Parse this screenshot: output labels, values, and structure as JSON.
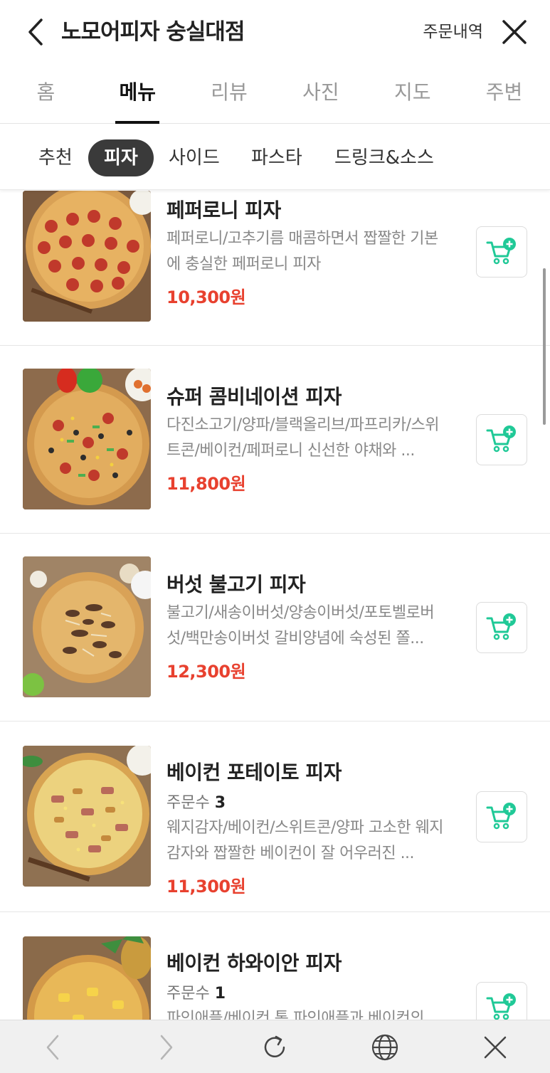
{
  "header": {
    "title": "노모어피자 숭실대점",
    "order_history": "주문내역"
  },
  "main_tabs": [
    "홈",
    "메뉴",
    "리뷰",
    "사진",
    "지도",
    "주변"
  ],
  "active_main_tab": "메뉴",
  "sub_tabs": [
    "추천",
    "피자",
    "사이드",
    "파스타",
    "드링크&소스"
  ],
  "active_sub_tab": "피자",
  "colors": {
    "price": "#e8412f",
    "cart_icon": "#20c997",
    "active_chip_bg": "#3a3a3a"
  },
  "menu_items": [
    {
      "name": "페퍼로니 피자",
      "description": "페퍼로니/고추기름 매콤하면서 짭짤한 기본에 충실한 페퍼로니 피자",
      "price": "10,300원"
    },
    {
      "name": "슈퍼 콤비네이션 피자",
      "description": "다진소고기/양파/블랙올리브/파프리카/스위트콘/베이컨/페퍼로니 신선한 야채와 ...",
      "price": "11,800원"
    },
    {
      "name": "버섯 불고기 피자",
      "description": "불고기/새송이버섯/양송이버섯/포토벨로버섯/백만송이버섯 갈비양념에 숙성된 쫄...",
      "price": "12,300원"
    },
    {
      "name": "베이컨 포테이토 피자",
      "order_label": "주문수",
      "order_count": "3",
      "description": "웨지감자/베이컨/스위트콘/양파 고소한 웨지감자와 짭짤한 베이컨이 잘 어우러진 ...",
      "price": "11,300원"
    },
    {
      "name": "베이컨 하와이안 피자",
      "order_label": "주문수",
      "order_count": "1",
      "description": "파인애플/베이컨 통 파인애플과 베이컨의",
      "price": ""
    }
  ],
  "icons": {
    "back": "chevron-left-icon",
    "close": "close-icon",
    "cart_add": "cart-plus-icon",
    "browser_back": "chevron-left-icon",
    "browser_forward": "chevron-right-icon",
    "browser_refresh": "refresh-icon",
    "browser_globe": "globe-icon",
    "browser_close": "close-icon"
  }
}
